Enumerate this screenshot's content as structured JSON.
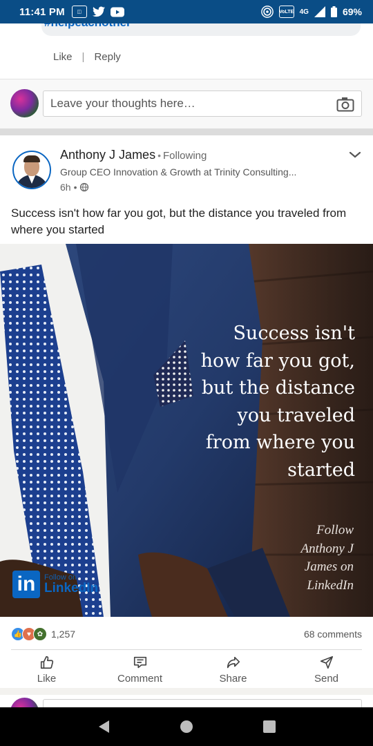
{
  "status_bar": {
    "time": "11:41 PM",
    "network": "4G",
    "battery": "69%",
    "volte_label": "VoLTE"
  },
  "previous_comment": {
    "hashtag": "#helpeachother",
    "like_label": "Like",
    "reply_label": "Reply"
  },
  "comment_box": {
    "placeholder": "Leave your thoughts here…"
  },
  "post": {
    "author": {
      "name": "Anthony J James",
      "relationship": "Following",
      "headline": "Group CEO Innovation & Growth at Trinity Consulting...",
      "time": "6h"
    },
    "text": "Success isn't how far you got, but the distance you traveled from where you started",
    "image": {
      "quote_lines": [
        "Success isn't",
        "how far you got,",
        "but the distance",
        "you traveled",
        "from where you",
        "started"
      ],
      "follow_lines": [
        "Follow",
        "Anthony J",
        "James on",
        "LinkedIn"
      ],
      "logo_small": "Follow on",
      "logo_big": "LinkedIn",
      "logo_mark": "in"
    },
    "reactions_count": "1,257",
    "comments_count": "68 comments",
    "actions": {
      "like": "Like",
      "comment": "Comment",
      "share": "Share",
      "send": "Send"
    }
  },
  "colors": {
    "status_bar": "#0a4d86",
    "linkedin_blue": "#0a66c2",
    "like_reaction": "#378fe9",
    "love_reaction": "#df704d",
    "support_reaction": "#44712e"
  }
}
